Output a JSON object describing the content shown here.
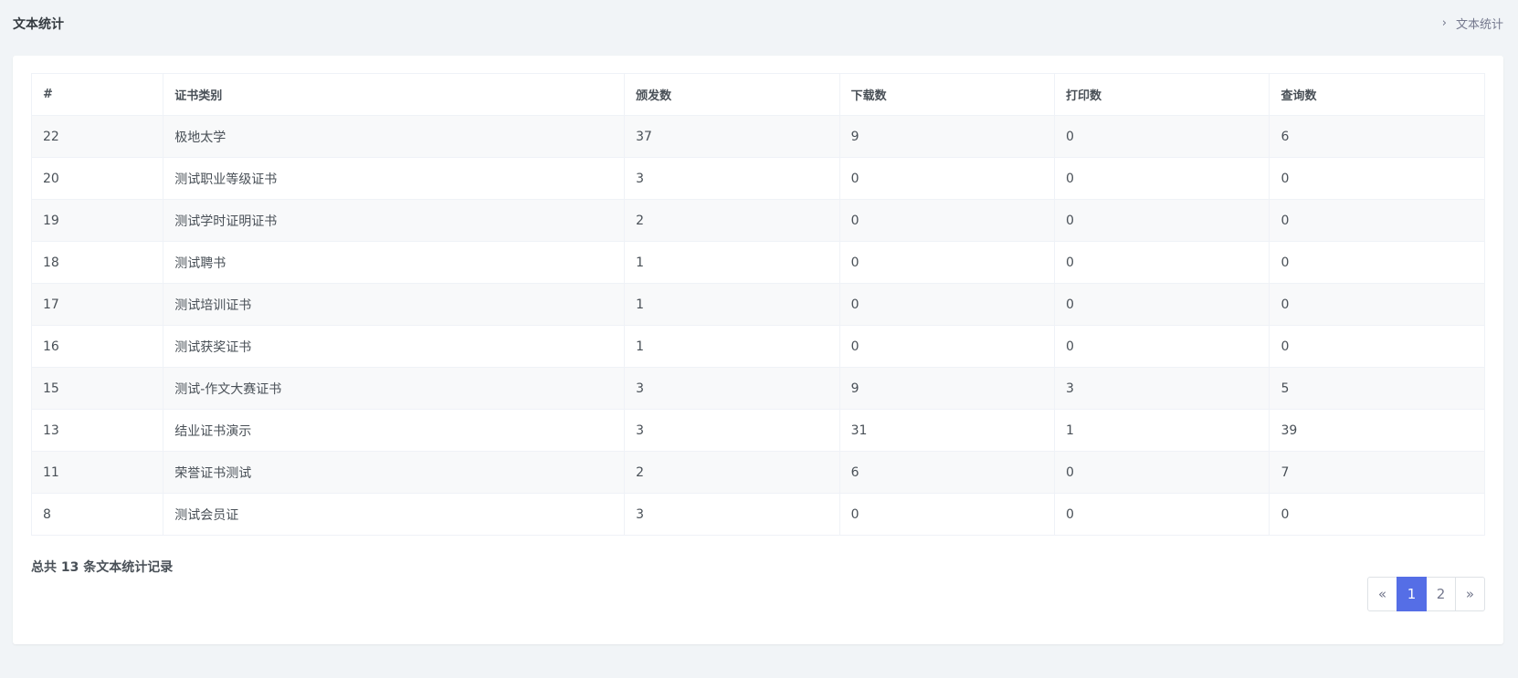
{
  "header": {
    "title": "文本统计",
    "breadcrumb": [
      "文本统计"
    ]
  },
  "table": {
    "columns": [
      "#",
      "证书类别",
      "颁发数",
      "下载数",
      "打印数",
      "查询数"
    ],
    "rows": [
      [
        "22",
        "极地太学",
        "37",
        "9",
        "0",
        "6"
      ],
      [
        "20",
        "测试职业等级证书",
        "3",
        "0",
        "0",
        "0"
      ],
      [
        "19",
        "测试学时证明证书",
        "2",
        "0",
        "0",
        "0"
      ],
      [
        "18",
        "测试聘书",
        "1",
        "0",
        "0",
        "0"
      ],
      [
        "17",
        "测试培训证书",
        "1",
        "0",
        "0",
        "0"
      ],
      [
        "16",
        "测试获奖证书",
        "1",
        "0",
        "0",
        "0"
      ],
      [
        "15",
        "测试-作文大赛证书",
        "3",
        "9",
        "3",
        "5"
      ],
      [
        "13",
        "结业证书演示",
        "3",
        "31",
        "1",
        "39"
      ],
      [
        "11",
        "荣誉证书测试",
        "2",
        "6",
        "0",
        "7"
      ],
      [
        "8",
        "测试会员证",
        "3",
        "0",
        "0",
        "0"
      ]
    ]
  },
  "summary": "总共 13 条文本统计记录",
  "pagination": {
    "prev": "«",
    "pages": [
      "1",
      "2"
    ],
    "active": "1",
    "next": "»"
  },
  "colors": {
    "accent": "#556ee6",
    "background": "#f1f4f7"
  }
}
